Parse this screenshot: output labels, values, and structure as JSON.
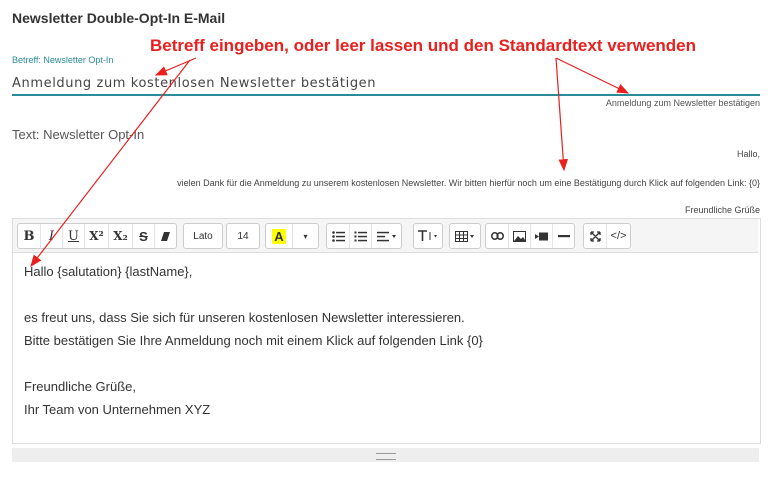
{
  "section_title": "Newsletter Double-Opt-In E-Mail",
  "subject": {
    "label": "Betreff: Newsletter Opt-In",
    "value": "Anmeldung zum kostenlosen Newsletter bestätigen",
    "default_text": "Anmeldung zum Newsletter bestätigen"
  },
  "text": {
    "label": "Text: Newsletter Opt-In",
    "default_lines": [
      "Hallo,",
      "vielen Dank für die Anmeldung zu unserem kostenlosen Newsletter. Wir bitten hierfür noch um eine Bestätigung durch Klick auf folgenden Link: {0}",
      "Freundliche Grüße"
    ]
  },
  "toolbar": {
    "bold": "B",
    "italic": "I",
    "underline": "U",
    "superscript": "X²",
    "subscript": "X₂",
    "strikethrough": "S",
    "font_name": "Lato",
    "font_size": "14",
    "highlight": "A"
  },
  "editor": {
    "lines": [
      "Hallo {salutation} {lastName},",
      "",
      "es freut uns, dass Sie sich für unseren kostenlosen Newsletter interessieren.",
      "Bitte bestätigen Sie Ihre Anmeldung noch mit einem Klick auf folgenden Link {0}",
      "",
      "Freundliche Grüße,",
      "Ihr Team von Unternehmen XYZ"
    ]
  },
  "annotation": {
    "text": "Betreff eingeben, oder leer lassen und den Standardtext verwenden",
    "color": "#e8201e"
  },
  "colors": {
    "accent": "#2a8c9b",
    "highlight": "#ffff00"
  }
}
